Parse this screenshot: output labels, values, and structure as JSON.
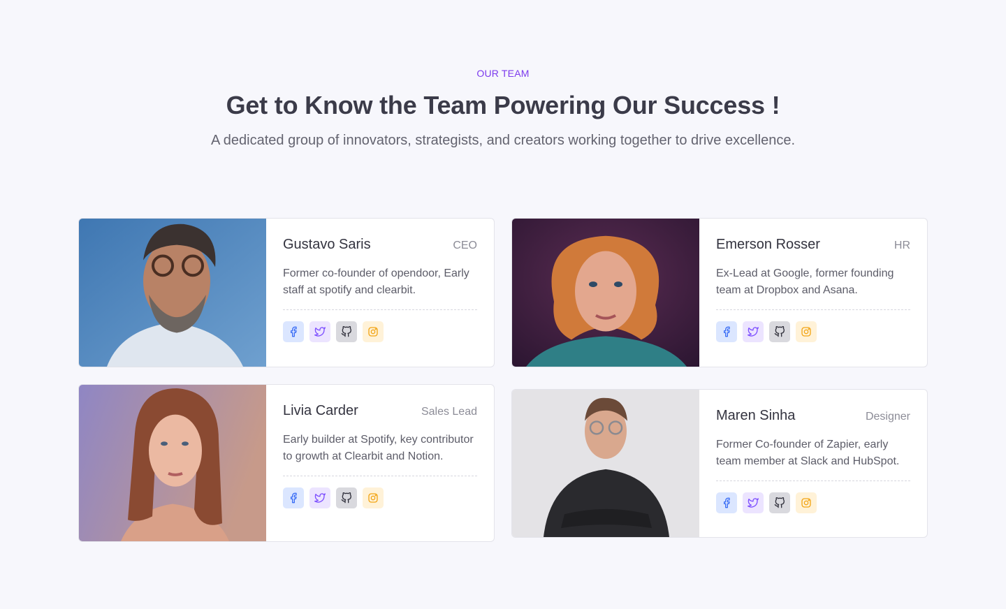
{
  "header": {
    "eyebrow": "OUR TEAM",
    "title": "Get to Know the Team Powering Our Success !",
    "subtitle": "A dedicated group of innovators, strategists, and creators working together to drive excellence."
  },
  "members": [
    {
      "name": "Gustavo Saris",
      "role": "CEO",
      "bio": "Former co-founder of opendoor, Early staff at spotify and clearbit."
    },
    {
      "name": "Emerson Rosser",
      "role": "HR",
      "bio": "Ex-Lead at Google, former founding team at Dropbox and Asana."
    },
    {
      "name": "Livia Carder",
      "role": "Sales Lead",
      "bio": "Early builder at Spotify, key contributor to growth at Clearbit and Notion."
    },
    {
      "name": "Maren Sinha",
      "role": "Designer",
      "bio": "Former Co-founder of Zapier, early team member at Slack and HubSpot."
    }
  ],
  "social_icons": [
    "facebook-icon",
    "twitter-icon",
    "github-icon",
    "instagram-icon"
  ],
  "colors": {
    "accent": "#7c3aed",
    "facebook": "#3b6ef5",
    "twitter": "#7c4dff",
    "github": "#2f2f3a",
    "instagram": "#f2a516"
  }
}
